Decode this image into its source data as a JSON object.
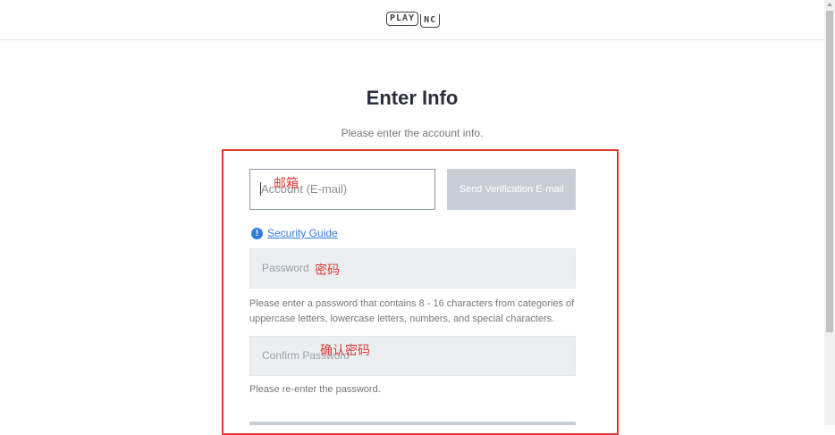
{
  "header": {
    "logo_part1": "PLAY",
    "logo_part2": "NC"
  },
  "page": {
    "title": "Enter Info",
    "subtitle": "Please enter the account info."
  },
  "form": {
    "email": {
      "placeholder": "Account (E-mail)",
      "annotation": "邮箱"
    },
    "send_button_label": "Send Verification E-mail",
    "security_guide": {
      "icon": "info-icon",
      "label": "Security Guide"
    },
    "password": {
      "placeholder": "Password",
      "annotation": "密码",
      "help": "Please enter a password that contains 8 - 16 characters from categories of uppercase letters, lowercase letters, numbers, and special characters."
    },
    "confirm_password": {
      "placeholder": "Confirm Password",
      "annotation": "确认密码",
      "help": "Please re-enter the password."
    }
  },
  "colors": {
    "annotation_red": "#e53935",
    "link_blue": "#2f7de1",
    "disabled_button": "#c9ced6"
  }
}
